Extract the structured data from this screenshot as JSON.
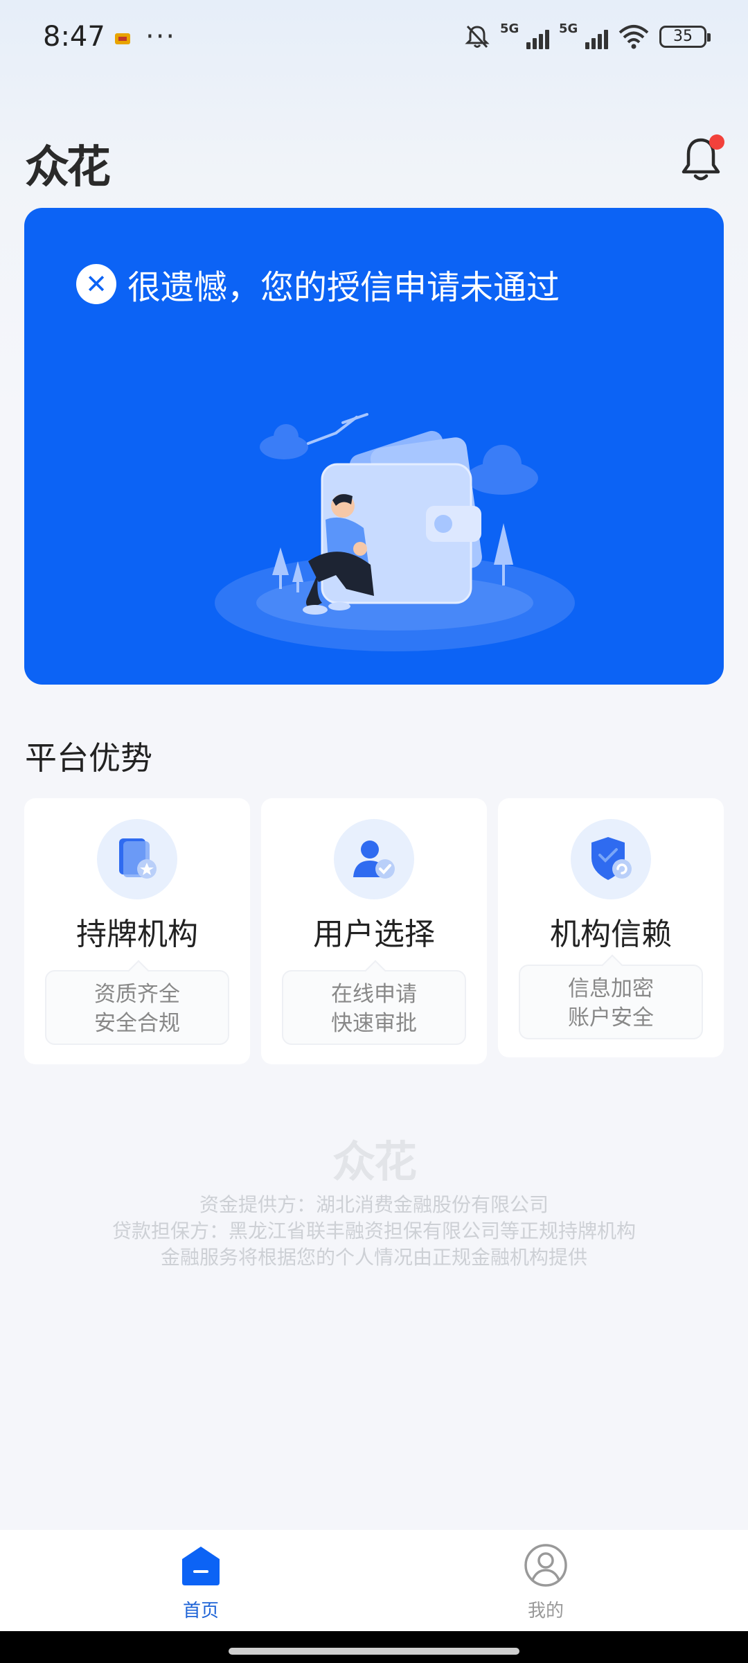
{
  "status_bar": {
    "time": "8:47",
    "more": "···",
    "network_1": "5G",
    "network_2": "5G",
    "battery": "35"
  },
  "header": {
    "logo": "众花",
    "bell_icon": "bell-icon",
    "has_unread": true
  },
  "banner": {
    "status_icon": "close-circle-icon",
    "message": "很遗憾，您的授信申请未通过",
    "background": "#0c63f5"
  },
  "section": {
    "title": "平台优势"
  },
  "advantages": [
    {
      "icon": "shield-star-icon",
      "title": "持牌机构",
      "line1": "资质齐全",
      "line2": "安全合规"
    },
    {
      "icon": "user-check-icon",
      "title": "用户选择",
      "line1": "在线申请",
      "line2": "快速审批"
    },
    {
      "icon": "shield-lock-icon",
      "title": "机构信赖",
      "line1": "信息加密",
      "line2": "账户安全"
    }
  ],
  "footer": {
    "logo": "众花",
    "line1": "资金提供方：湖北消费金融股份有限公司",
    "line2": "贷款担保方：黑龙江省联丰融资担保有限公司等正规持牌机构",
    "line3": "金融服务将根据您的个人情况由正规金融机构提供"
  },
  "tabbar": {
    "home": "首页",
    "mine": "我的",
    "active": "home",
    "accent": "#1e63d6"
  }
}
